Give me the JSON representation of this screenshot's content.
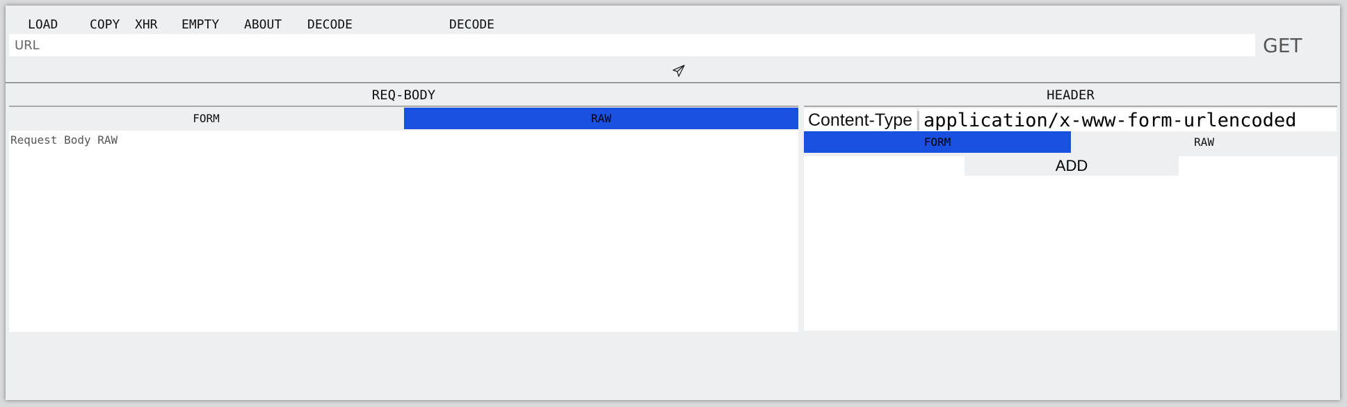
{
  "menu": {
    "load": "LOAD",
    "copy": "COPY",
    "xhr": "XHR",
    "empty": "EMPTY",
    "about": "ABOUT",
    "decode": "DECODE",
    "decode2": "DECODE"
  },
  "url": {
    "placeholder": "URL",
    "value": ""
  },
  "method": "GET",
  "send_icon": "paper-plane-icon",
  "req_body": {
    "title": "REQ-BODY",
    "tabs": {
      "form": "FORM",
      "raw": "RAW"
    },
    "active_tab": "RAW",
    "raw_placeholder": "Request Body RAW",
    "raw_value": ""
  },
  "header": {
    "title": "HEADER",
    "content_type_key": "Content-Type",
    "content_type_value": "application/x-www-form-urlencoded",
    "tabs": {
      "form": "FORM",
      "raw": "RAW"
    },
    "active_tab": "FORM",
    "add_label": "ADD"
  },
  "colors": {
    "accent": "#1a50e0",
    "background": "#eeeff1",
    "input_bg": "#ffffff"
  }
}
